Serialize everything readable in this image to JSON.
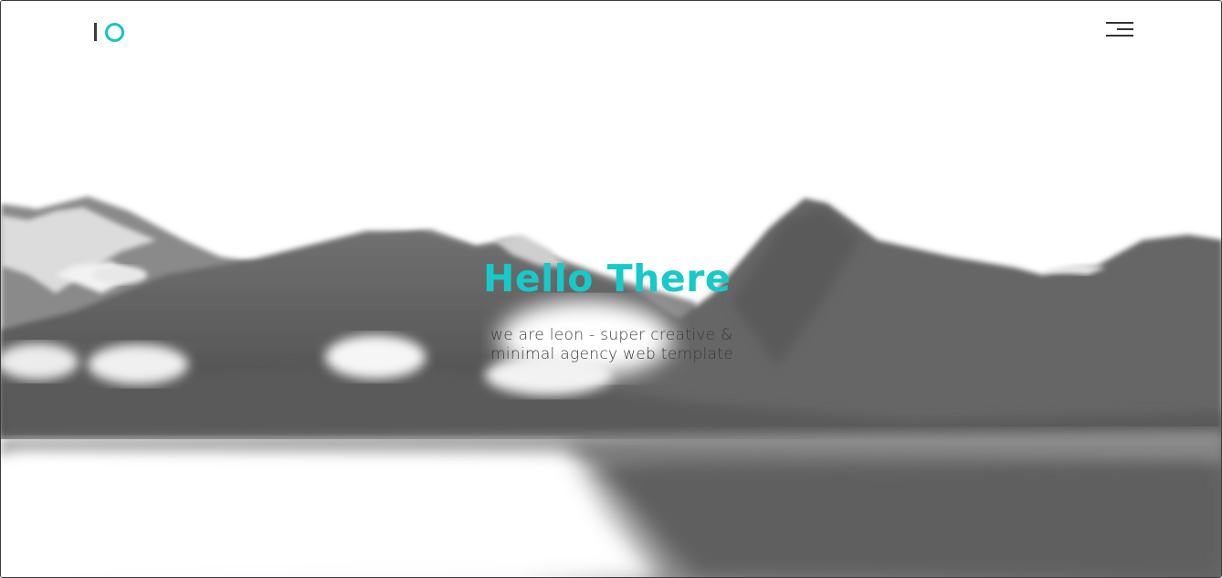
{
  "header": {
    "logo_name": "logo-io",
    "menu_icon": "hamburger-menu-icon"
  },
  "hero": {
    "title": "Hello There",
    "subtitle": "we are leon - super creative & minimal agency web template"
  },
  "colors": {
    "accent": "#17c9c9",
    "text": "#3b3b3b",
    "background": "#ffffff"
  }
}
